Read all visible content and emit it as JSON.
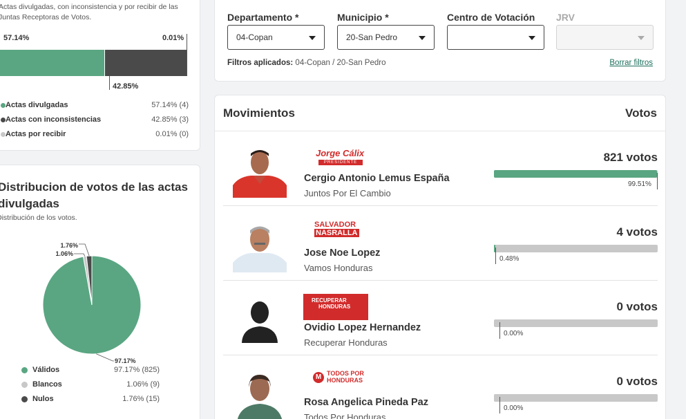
{
  "colors": {
    "accent": "#5aa682",
    "dark": "#4a4a4a",
    "light": "#c8c8c8",
    "link": "#1c6e5c"
  },
  "actas_card": {
    "description_line1": "Actas divulgadas, con inconsistencia y por recibir de las",
    "description_line2": "Juntas Receptoras de Votos.",
    "pct_divulgadas": "57.14%",
    "pct_inconsistencias": "42.85%",
    "pct_por_recibir": "0.01%",
    "bar_fractions": {
      "divulgadas": 0.5714,
      "inconsistencias": 0.4285,
      "por_recibir": 0.0001
    },
    "legend": [
      {
        "label": "Actas divulgadas",
        "value": "57.14% (4)",
        "color": "#5aa682"
      },
      {
        "label": "Actas con inconsistencias",
        "value": "42.85% (3)",
        "color": "#4a4a4a"
      },
      {
        "label": "Actas por recibir",
        "value": "0.01% (0)",
        "color": "#c8c8c8"
      }
    ]
  },
  "distribucion_card": {
    "title": "Distribucion de votos de las actas divulgadas",
    "subtitle": "Distribución de los votos.",
    "legend": [
      {
        "label": "Válidos",
        "value": "97.17% (825)",
        "color": "#5aa682"
      },
      {
        "label": "Blancos",
        "value": "1.06% (9)",
        "color": "#c8c8c8"
      },
      {
        "label": "Nulos",
        "value": "1.76% (15)",
        "color": "#4a4a4a"
      }
    ]
  },
  "chart_data": {
    "type": "pie",
    "categories": [
      "Válidos",
      "Blancos",
      "Nulos"
    ],
    "values": [
      97.17,
      1.06,
      1.76
    ],
    "counts": [
      825,
      9,
      15
    ],
    "data_labels": [
      "97.17%",
      "1.06%",
      "1.76%"
    ],
    "colors": [
      "#5aa682",
      "#c8c8c8",
      "#4a4a4a"
    ]
  },
  "filters": {
    "departamento_label": "Departamento *",
    "departamento_value": "04-Copan",
    "municipio_label": "Municipio *",
    "municipio_value": "20-San Pedro",
    "centro_label": "Centro de Votación",
    "centro_value": "",
    "jrv_label": "JRV",
    "jrv_value": "",
    "applied_label": "Filtros aplicados:",
    "applied_value": "04-Copan / 20-San Pedro",
    "clear_label": "Borrar filtros"
  },
  "movimientos": {
    "title": "Movimientos",
    "votes_header": "Votos",
    "candidates": [
      {
        "name": "Cergio Antonio Lemus España",
        "party": "Juntos Por El Cambio",
        "votes": "821 votos",
        "pct": "99.51%",
        "fraction": 0.9951,
        "logo_top": "Jorge Cálix",
        "logo_bottom": "PRESIDENTE"
      },
      {
        "name": "Jose Noe Lopez",
        "party": "Vamos Honduras",
        "votes": "4 votos",
        "pct": "0.48%",
        "fraction": 0.0048,
        "logo_top": "SALVADOR",
        "logo_bottom": "NASRALLA"
      },
      {
        "name": "Ovidio Lopez Hernandez",
        "party": "Recuperar Honduras",
        "votes": "0 votos",
        "pct": "0.00%",
        "fraction": 0.0,
        "logo_top": "RECUPERAR",
        "logo_bottom": "HONDURAS"
      },
      {
        "name": "Rosa Angelica Pineda Paz",
        "party": "Todos Por Honduras",
        "votes": "0 votos",
        "pct": "0.00%",
        "fraction": 0.0,
        "logo_top": "TODOS POR",
        "logo_bottom": "HONDURAS"
      }
    ]
  }
}
